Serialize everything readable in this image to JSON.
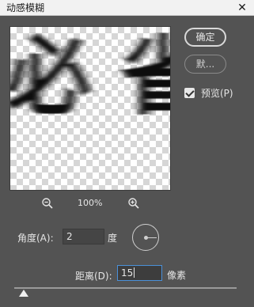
{
  "window": {
    "title": "动感模糊",
    "close_glyph": "✕"
  },
  "buttons": {
    "ok": "确定",
    "default": "默..."
  },
  "preview_toggle": {
    "label": "预览(P)",
    "checked": true
  },
  "zoom": {
    "level": "100%"
  },
  "angle": {
    "label": "角度(A):",
    "value": "2",
    "unit": "度"
  },
  "distance": {
    "label": "距离(D):",
    "value": "15",
    "unit": "像素"
  },
  "icons": {
    "zoom_out": "zoom-out-icon",
    "zoom_in": "zoom-in-icon",
    "close": "close-icon",
    "dial": "angle-dial"
  },
  "preview": {
    "glyphs": [
      "必",
      "省"
    ]
  }
}
